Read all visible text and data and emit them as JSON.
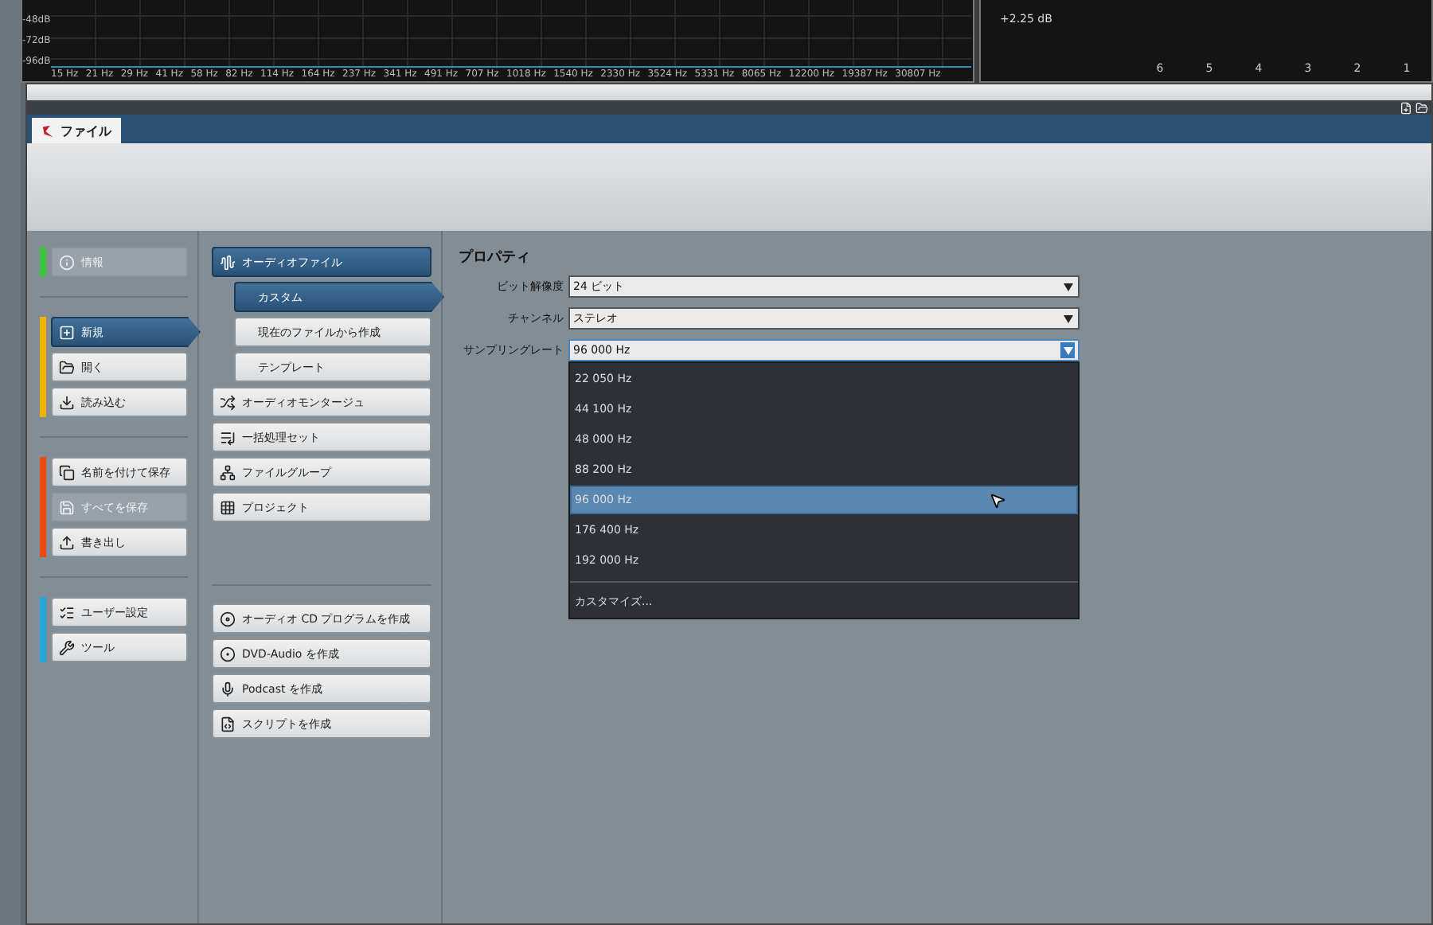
{
  "spectrum": {
    "y_labels": [
      "-48dB",
      "-72dB",
      "-96dB"
    ],
    "x_labels": [
      "15 Hz",
      "21 Hz",
      "29 Hz",
      "41 Hz",
      "58 Hz",
      "82 Hz",
      "114 Hz",
      "164 Hz",
      "237 Hz",
      "341 Hz",
      "491 Hz",
      "707 Hz",
      "1018 Hz",
      "1540 Hz",
      "2330 Hz",
      "3524 Hz",
      "5331 Hz",
      "8065 Hz",
      "12200 Hz",
      "19387 Hz",
      "30807 Hz"
    ]
  },
  "meter": {
    "reading": "+2.25 dB",
    "scale": [
      "6",
      "5",
      "4",
      "3",
      "2",
      "1"
    ]
  },
  "tabs": [
    {
      "label": "ファイル",
      "selected": true
    }
  ],
  "left_panel": {
    "groups": [
      {
        "color": "#3cc43c",
        "buttons": [
          {
            "label": "情報",
            "kind": "info",
            "selected": false,
            "disabled": true
          }
        ]
      },
      {
        "color": "#f0b400",
        "buttons": [
          {
            "label": "新規",
            "kind": "new",
            "selected": true,
            "disabled": false
          },
          {
            "label": "開く",
            "kind": "open",
            "selected": false,
            "disabled": false
          },
          {
            "label": "読み込む",
            "kind": "import",
            "selected": false,
            "disabled": false
          }
        ]
      },
      {
        "color": "#ee4a10",
        "buttons": [
          {
            "label": "名前を付けて保存",
            "kind": "saveas",
            "selected": false,
            "disabled": false
          },
          {
            "label": "すべてを保存",
            "kind": "saveall",
            "selected": false,
            "disabled": true
          },
          {
            "label": "書き出し",
            "kind": "export",
            "selected": false,
            "disabled": false
          }
        ]
      },
      {
        "color": "#21a8d8",
        "buttons": [
          {
            "label": "ユーザー設定",
            "kind": "prefs",
            "selected": false,
            "disabled": false
          },
          {
            "label": "ツール",
            "kind": "tools",
            "selected": false,
            "disabled": false
          }
        ]
      }
    ]
  },
  "middle_panel": {
    "groups": [
      {
        "items": [
          {
            "label": "オーディオファイル",
            "kind": "wave",
            "selected": true,
            "children": [
              {
                "label": "カスタム",
                "selected": true
              },
              {
                "label": "現在のファイルから作成",
                "selected": false
              },
              {
                "label": "テンプレート",
                "selected": false
              }
            ]
          },
          {
            "label": "オーディオモンタージュ",
            "kind": "montage",
            "selected": false
          },
          {
            "label": "一括処理セット",
            "kind": "batch",
            "selected": false
          },
          {
            "label": "ファイルグループ",
            "kind": "group",
            "selected": false
          },
          {
            "label": "プロジェクト",
            "kind": "project",
            "selected": false
          }
        ]
      },
      {
        "items": [
          {
            "label": "オーディオ CD プログラムを作成",
            "kind": "cd",
            "selected": false
          },
          {
            "label": "DVD-Audio を作成",
            "kind": "dvd",
            "selected": false
          },
          {
            "label": "Podcast を作成",
            "kind": "podcast",
            "selected": false
          },
          {
            "label": "スクリプトを作成",
            "kind": "script",
            "selected": false
          }
        ]
      }
    ]
  },
  "properties": {
    "title": "プロパティ",
    "fields": [
      {
        "label": "ビット解像度",
        "value": "24 ビット",
        "expanded": false
      },
      {
        "label": "チャンネル",
        "value": "ステレオ",
        "expanded": false
      },
      {
        "label": "サンプリングレート",
        "value": "96 000 Hz",
        "expanded": true
      }
    ],
    "dropdown": {
      "options": [
        {
          "label": "22 050 Hz",
          "selected": false
        },
        {
          "label": "44 100 Hz",
          "selected": false
        },
        {
          "label": "48 000 Hz",
          "selected": false
        },
        {
          "label": "88 200 Hz",
          "selected": false
        },
        {
          "label": "96 000 Hz",
          "selected": true
        },
        {
          "label": "176 400 Hz",
          "selected": false
        },
        {
          "label": "192 000 Hz",
          "selected": false
        }
      ],
      "customize": "カスタマイズ..."
    }
  }
}
